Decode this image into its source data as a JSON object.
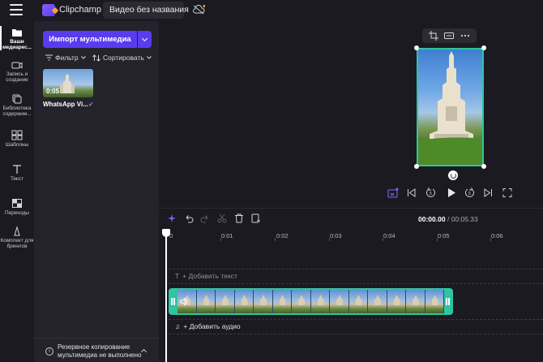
{
  "app": {
    "name": "Clipchamp",
    "project_title": "Видео без названия"
  },
  "sidebar": {
    "items": [
      {
        "label": "Ваши медиарес...",
        "icon": "folder-icon",
        "active": true
      },
      {
        "label": "Запись и создание",
        "icon": "camera-icon"
      },
      {
        "label": "Библиотека содержим...",
        "icon": "library-icon"
      },
      {
        "label": "Шаблоны",
        "icon": "templates-icon"
      },
      {
        "label": "Текст",
        "icon": "text-icon"
      },
      {
        "label": "Переходы",
        "icon": "transitions-icon"
      },
      {
        "label": "Комплект для бренлов",
        "icon": "brand-kit-icon"
      }
    ]
  },
  "media_panel": {
    "import_label": "Импорт мультимедиа",
    "filter_label": "Фильтр",
    "sort_label": "Сортировать",
    "media": [
      {
        "name": "WhatsApp Vi...",
        "duration": "0:05",
        "added": true
      }
    ],
    "backup_notice": "Резервное копирование мультимедиа не выполнено"
  },
  "preview": {
    "tools": [
      "crop-icon",
      "fit-icon",
      "more-icon"
    ],
    "accent_color": "#2fc4a2"
  },
  "timeline": {
    "current_time": "00:00.00",
    "total_time": "/ 00:05.33",
    "ticks": [
      "0",
      "0:01",
      "0:02",
      "0:03",
      "0:04",
      "0:05",
      "0:06"
    ],
    "add_text_label": "+ Добавить текст",
    "add_audio_label": "+ Добавить аудио"
  }
}
